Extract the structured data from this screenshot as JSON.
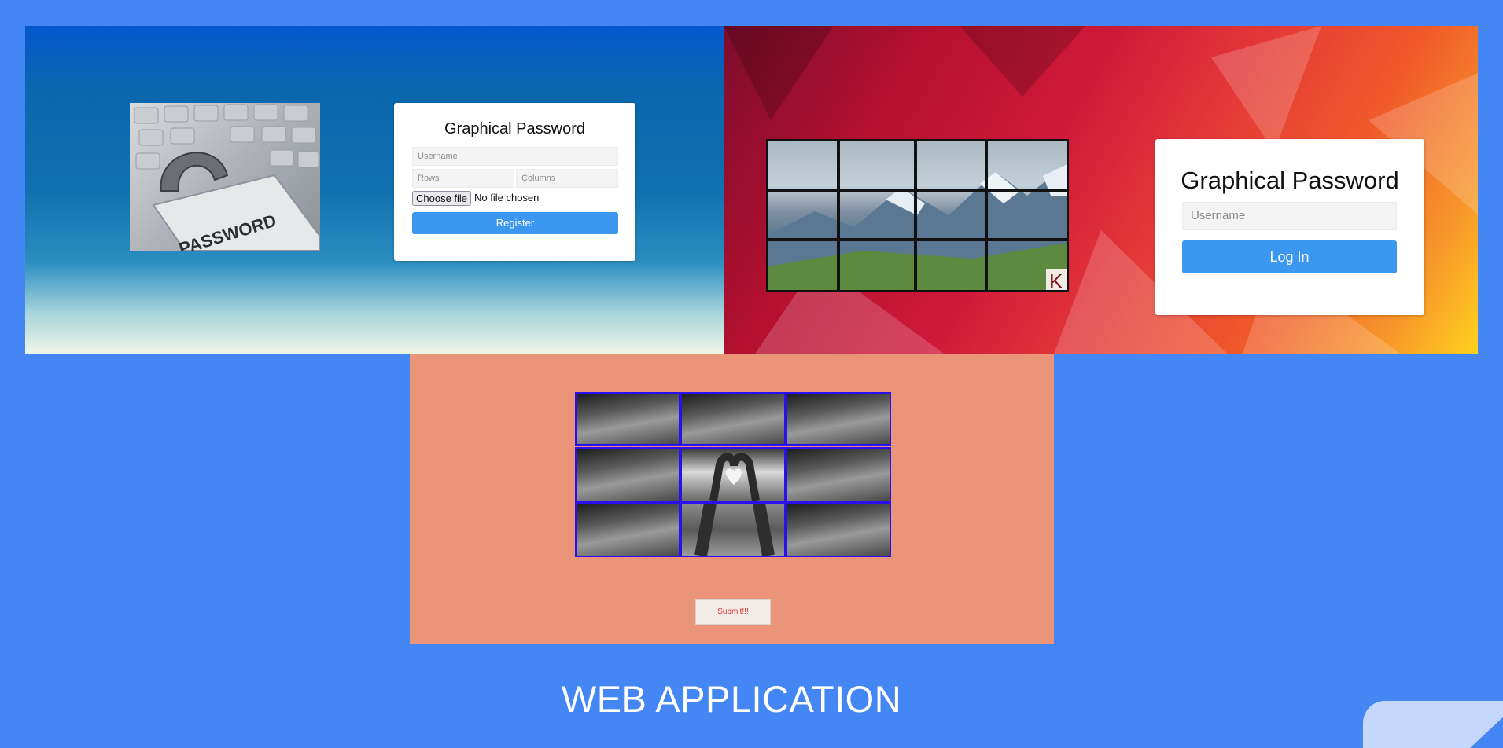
{
  "register_screen": {
    "lock_image_text": "PASSWORD",
    "title": "Graphical Password",
    "username_placeholder": "Username",
    "rows_placeholder": "Rows",
    "columns_placeholder": "Columns",
    "choose_file_label": "Choose file",
    "file_status": "No file chosen",
    "register_label": "Register"
  },
  "login_screen": {
    "grid_rows": 3,
    "grid_cols": 4,
    "watermark": "K",
    "title": "Graphical Password",
    "username_placeholder": "Username",
    "login_label": "Log In"
  },
  "select_screen": {
    "grid_rows": 3,
    "grid_cols": 3,
    "cell_border_color": "#2a10f0",
    "submit_label": "Submit!!!"
  },
  "caption": "WEB APPLICATION",
  "colors": {
    "page_background": "#4486f4",
    "button_blue": "#3b97ef",
    "select_panel": "#ea957a"
  }
}
